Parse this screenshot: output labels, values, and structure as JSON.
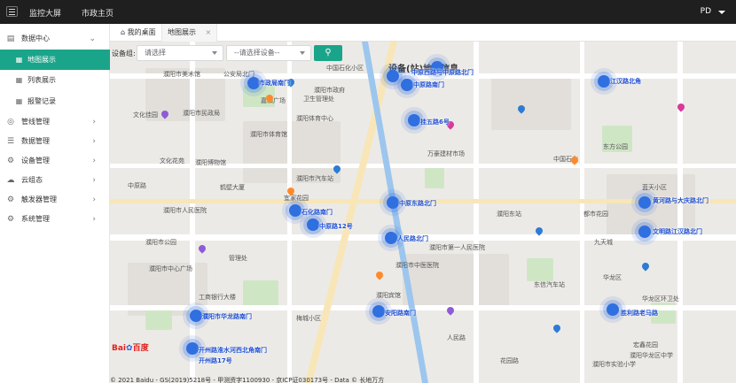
{
  "topbar": {
    "nav": [
      {
        "label": "监控大屏"
      },
      {
        "label": "市政主页"
      }
    ],
    "user": "PD"
  },
  "sidebar": {
    "items": [
      {
        "label": "数据中心",
        "icon": "file-icon",
        "expanded": true
      },
      {
        "label": "地图展示",
        "icon": "grid-icon",
        "sub": true,
        "active": true
      },
      {
        "label": "列表展示",
        "icon": "grid-icon",
        "sub": true
      },
      {
        "label": "报警记录",
        "icon": "grid-icon",
        "sub": true
      },
      {
        "label": "管线管理",
        "icon": "compass-icon"
      },
      {
        "label": "数据管理",
        "icon": "database-icon"
      },
      {
        "label": "设备管理",
        "icon": "gear-icon"
      },
      {
        "label": "云组态",
        "icon": "cloud-icon"
      },
      {
        "label": "触发器管理",
        "icon": "gear-icon"
      },
      {
        "label": "系统管理",
        "icon": "gear-icon"
      }
    ]
  },
  "tabs": [
    {
      "label": "我的桌面",
      "icon": "home-icon"
    },
    {
      "label": "地图展示",
      "closable": true
    }
  ],
  "filters": {
    "group_label": "设备组:",
    "group_placeholder": "请选择",
    "device_placeholder": "--请选择设备--"
  },
  "map": {
    "title": "设备(站)地图信息",
    "logo": "Bai",
    "logo_suffix": "百度",
    "copyright": "© 2021 Baidu - GS(2019)5218号 - 甲测资字1100930 - 京ICP证030173号 - Data © 长地万方",
    "places": [
      "中国石化小区",
      "公安局北门",
      "濮阳市美术馆",
      "濮阳市政府",
      "卫生管理处",
      "嘉和广场",
      "文化佳园",
      "濮阳市民政局",
      "濮阳体育中心",
      "万豪建材市场",
      "濮阳市体育馆",
      "文化花苑",
      "濮阳博物馆",
      "濮阳市汽车站",
      "中国石化",
      "濮阳市人民医院",
      "濮阳市公园",
      "管理处",
      "濮阳市中心广场",
      "中原路",
      "工商银行大楼",
      "濮阳市中医医院",
      "鹤壁大厦",
      "宜家花园",
      "濮阳市第一人民医院",
      "濮阳宾馆",
      "濮阳东站",
      "都市花园",
      "华龙区",
      "东方公园",
      "梅城小区",
      "九天城",
      "东信汽车站",
      "宏鑫花园",
      "濮阳华龙区中学",
      "濮阳市实验小学",
      "蓝天小区",
      "华龙区环卫处",
      "花园路",
      "人民路"
    ],
    "devices": [
      {
        "label": "市政局南门"
      },
      {
        "label": "中原西路与中原路北门"
      },
      {
        "label": "中原路南门"
      },
      {
        "label": "江汉路北角"
      },
      {
        "label": "挂五路6号"
      },
      {
        "label": "中原路北大"
      },
      {
        "label": "石化路南门"
      },
      {
        "label": "中原东路北门"
      },
      {
        "label": "中原路12号"
      },
      {
        "label": "人民路北门"
      },
      {
        "label": "安阳路南门"
      },
      {
        "label": "黄河路与大庆路北门"
      },
      {
        "label": "文明路江汉路北门"
      },
      {
        "label": "胜利路老马路"
      },
      {
        "label": "濮阳市华龙路南门"
      },
      {
        "label": "开州路淮水河西北角南门"
      },
      {
        "label": "开州路17号"
      }
    ]
  }
}
